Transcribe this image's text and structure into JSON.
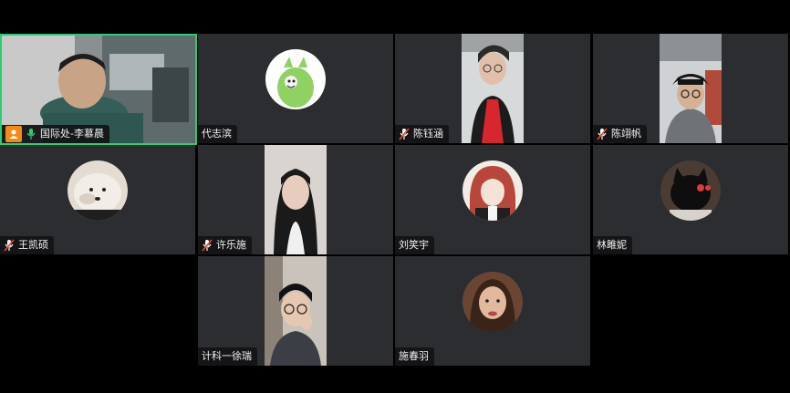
{
  "participants": [
    {
      "name": "国际处-李慕晨"
    },
    {
      "name": "代志滨"
    },
    {
      "name": "陈钰涵"
    },
    {
      "name": "陈翊帆"
    },
    {
      "name": "王凯硕"
    },
    {
      "name": "许乐施"
    },
    {
      "name": "刘笑宇"
    },
    {
      "name": "林雎妮"
    },
    {
      "name": "计科一徐瑞"
    },
    {
      "name": "施春羽"
    }
  ]
}
